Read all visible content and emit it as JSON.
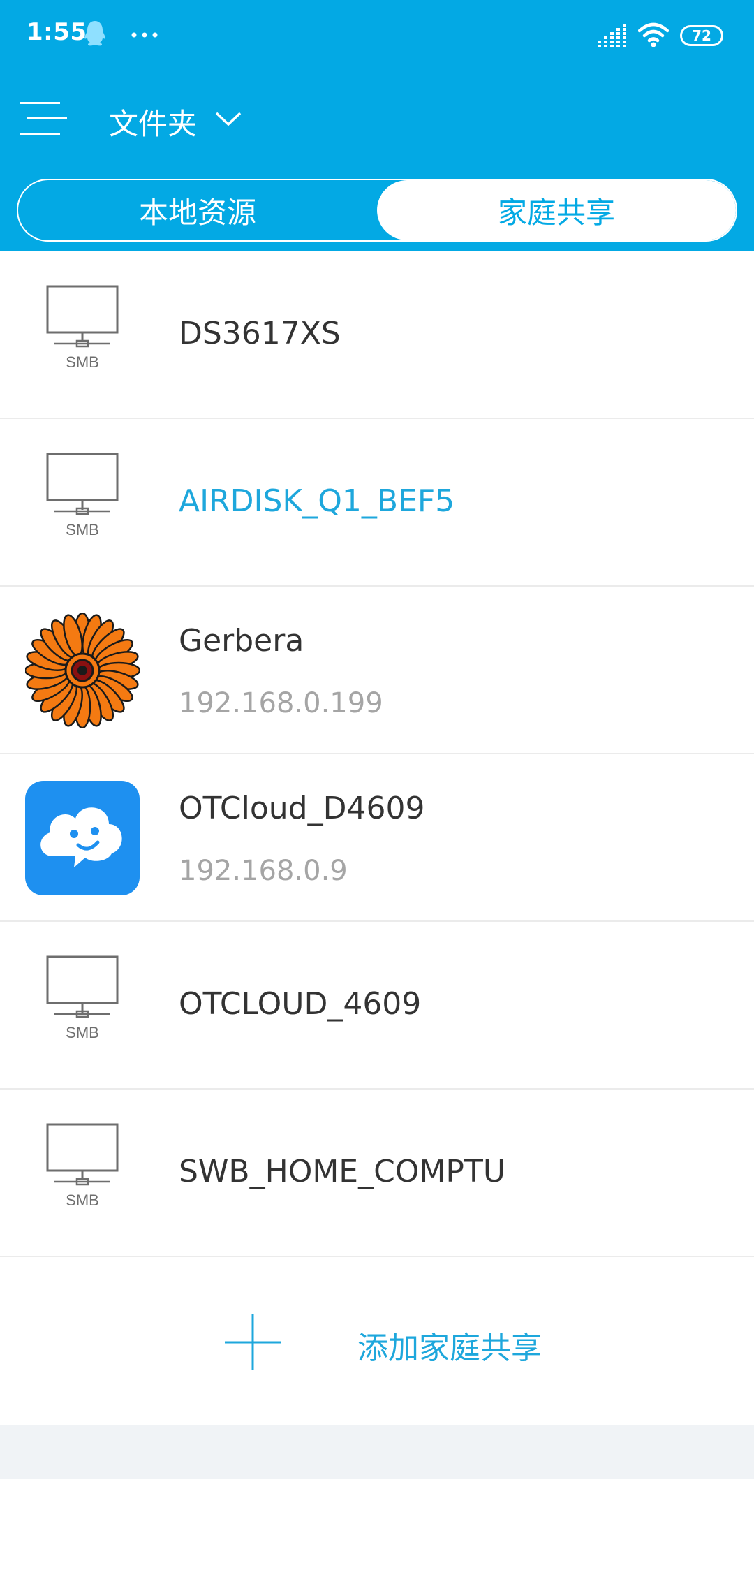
{
  "status_bar": {
    "time": "1:55",
    "battery": "72",
    "icons": [
      "qq-icon",
      "more-dots-icon",
      "signal-icon",
      "wifi-icon",
      "battery-icon"
    ]
  },
  "title_bar": {
    "title": "文件夹",
    "icons": [
      "menu-icon",
      "chevron-down-icon"
    ]
  },
  "tabs": {
    "items": [
      {
        "label": "本地资源",
        "active": false
      },
      {
        "label": "家庭共享",
        "active": true
      }
    ]
  },
  "shares": [
    {
      "name": "DS3617XS",
      "icon": "smb-monitor-icon",
      "icon_label": "SMB"
    },
    {
      "name": "AIRDISK_Q1_BEF5",
      "icon": "smb-monitor-icon",
      "icon_label": "SMB",
      "highlighted": true
    },
    {
      "name": "Gerbera",
      "ip": "192.168.0.199",
      "icon": "gerbera-flower-icon"
    },
    {
      "name": "OTCloud_D4609",
      "ip": "192.168.0.9",
      "icon": "otcloud-icon"
    },
    {
      "name": "OTCLOUD_4609",
      "icon": "smb-monitor-icon",
      "icon_label": "SMB"
    },
    {
      "name": "SWB_HOME_COMPTU",
      "icon": "smb-monitor-icon",
      "icon_label": "SMB"
    }
  ],
  "add_share": {
    "label": "添加家庭共享",
    "icon": "plus-icon"
  },
  "colors": {
    "header": "#03a9e4",
    "accent": "#1ea7dc",
    "text": "#333333",
    "subtext": "#a5a5a5",
    "divider": "#ebebeb"
  }
}
